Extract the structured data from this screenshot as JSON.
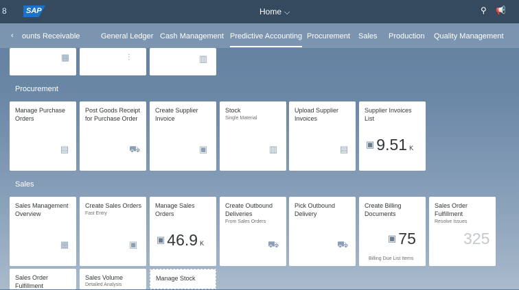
{
  "shell": {
    "user_initial": "8",
    "logo": "SAP",
    "title": "Home",
    "title_chevron": "⌵",
    "search_icon": "⚲",
    "notification_icon": "📢"
  },
  "tabs": {
    "prev_arrow": "‹",
    "items": [
      {
        "label": "ounts Receivable"
      },
      {
        "label": "General Ledger"
      },
      {
        "label": "Cash Management"
      },
      {
        "label": "Predictive Accounting",
        "selected": true
      },
      {
        "label": "Procurement"
      },
      {
        "label": "Sales"
      },
      {
        "label": "Production"
      },
      {
        "label": "Quality Management"
      }
    ]
  },
  "top_row": {
    "icons": [
      "▦",
      "⫶",
      "▥"
    ]
  },
  "procurement": {
    "title": "Procurement",
    "tiles": [
      {
        "title": "Manage Purchase Orders",
        "icon": "▤"
      },
      {
        "title": "Post Goods Receipt for Purchase Order",
        "icon": "⛟"
      },
      {
        "title": "Create Supplier Invoice",
        "icon": "▣"
      },
      {
        "title": "Stock",
        "subtitle": "Single Material",
        "icon": "▥"
      },
      {
        "title": "Upload Supplier Invoices",
        "icon": "▤"
      },
      {
        "title": "Supplier Invoices List",
        "kpi_icon": "▣",
        "kpi_value": "9.51",
        "kpi_scale": "K"
      }
    ]
  },
  "sales": {
    "title": "Sales",
    "tiles": [
      {
        "title": "Sales Management Overview",
        "icon": "▦"
      },
      {
        "title": "Create Sales Orders",
        "subtitle": "Fast Entry",
        "icon": "▣"
      },
      {
        "title": "Manage Sales Orders",
        "kpi_icon": "▣",
        "kpi_value": "46.9",
        "kpi_scale": "K"
      },
      {
        "title": "Create Outbound Deliveries",
        "subtitle": "From Sales Orders",
        "icon": "⛟"
      },
      {
        "title": "Pick Outbound Delivery",
        "icon": "⛟"
      },
      {
        "title": "Create Billing Documents",
        "kpi_icon": "▣",
        "kpi_value": "75",
        "footer": "Billing Due List Items"
      },
      {
        "title": "Sales Order Fulfillment",
        "subtitle": "Resolve Issues",
        "kpi_value": "325"
      }
    ],
    "bottom_tiles": [
      {
        "title": "Sales Order Fulfillment"
      },
      {
        "title": "Sales Volume",
        "subtitle": "Detailed Analysis"
      },
      {
        "title": "Manage Stock"
      }
    ]
  }
}
